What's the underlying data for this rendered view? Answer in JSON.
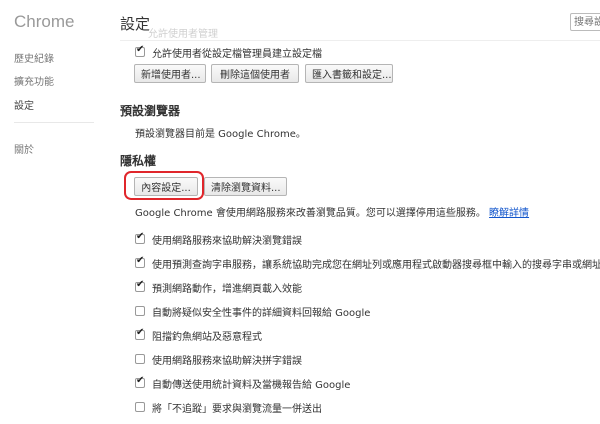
{
  "sidebar": {
    "brand": "Chrome",
    "items": [
      {
        "label": "歷史紀錄"
      },
      {
        "label": "擴充功能"
      },
      {
        "label": "設定"
      },
      {
        "label": "關於"
      }
    ]
  },
  "header": {
    "title": "設定",
    "search_placeholder": "搜尋設"
  },
  "users": {
    "faded_text": "允許使用者管理",
    "allow_checkbox_label": "允許使用者從設定檔管理員建立設定檔",
    "add_user_button": "新增使用者...",
    "delete_user_button": "刪除這個使用者",
    "import_button": "匯入書籤和設定..."
  },
  "default_browser": {
    "title": "預設瀏覽器",
    "text": "預設瀏覽器目前是 Google Chrome。"
  },
  "privacy": {
    "title": "隱私權",
    "content_settings_button": "內容設定...",
    "clear_data_button": "清除瀏覽資料...",
    "description": "Google Chrome 會使用網路服務來改善瀏覽品質。您可以選擇停用這些服務。",
    "learn_more_link": "瞭解詳情",
    "options": [
      {
        "label": "使用網路服務來協助解決瀏覽錯誤",
        "checked": true
      },
      {
        "label": "使用預測查詢字串服務，讓系統協助完成您在網址列或應用程式啟動器搜尋框中輸入的搜尋字串或網址",
        "checked": true
      },
      {
        "label": "預測網路動作，增進網頁載入效能",
        "checked": true
      },
      {
        "label": "自動將疑似安全性事件的詳細資料回報給 Google",
        "checked": false
      },
      {
        "label": "阻擋釣魚網站及惡意程式",
        "checked": true
      },
      {
        "label": "使用網路服務來協助解決拼字錯誤",
        "checked": false
      },
      {
        "label": "自動傳送使用統計資料及當機報告給 Google",
        "checked": true
      },
      {
        "label": "將「不追蹤」要求與瀏覽流量一併送出",
        "checked": false
      }
    ]
  }
}
